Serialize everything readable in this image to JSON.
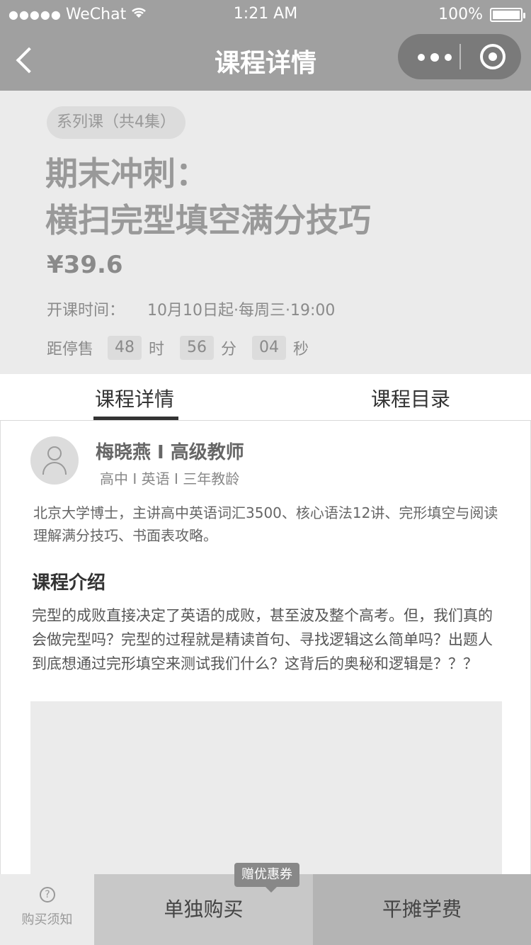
{
  "status_bar": {
    "carrier": "WeChat",
    "time": "1:21 AM",
    "battery": "100%"
  },
  "nav": {
    "title": "课程详情"
  },
  "course": {
    "series_badge": "系列课（共4集）",
    "title_line1": "期末冲刺：",
    "title_line2": "横扫完型填空满分技巧",
    "price": "¥39.6",
    "open_time_label": "开课时间：",
    "open_time_value": "10月10日起·每周三·19:00",
    "countdown_label": "距停售",
    "hours": "48",
    "hours_unit": "时",
    "minutes": "56",
    "minutes_unit": "分",
    "seconds": "04",
    "seconds_unit": "秒"
  },
  "tabs": {
    "detail": "课程详情",
    "catalog": "课程目录"
  },
  "teacher": {
    "name": "梅晓燕 I 高级教师",
    "meta": "高中 I 英语 I 三年教龄",
    "bio": "北京大学博士，主讲高中英语词汇3500、核心语法12讲、完形填空与阅读理解满分技巧、书面表攻略。"
  },
  "intro": {
    "heading": "课程介绍",
    "text": "完型的成败直接决定了英语的成败，甚至波及整个高考。但，我们真的会做完型吗？完型的过程就是精读首句、寻找逻辑这么简单吗？出题人到底想通过完形填空来测试我们什么？这背后的奥秘和逻辑是？？？"
  },
  "bottom": {
    "notice_label": "购买须知",
    "notice_icon": "?",
    "buy_single": "单独购买",
    "buy_split": "平摊学费",
    "coupon_tag": "赠优惠券"
  }
}
